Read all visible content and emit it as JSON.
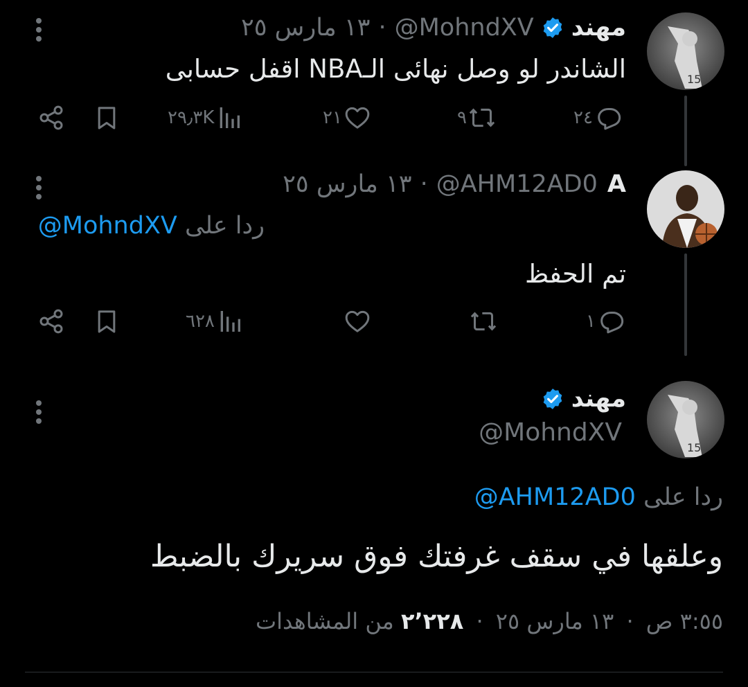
{
  "tweets": [
    {
      "author_name": "مهند",
      "verified": true,
      "handle": "@MohndXV",
      "separator": "·",
      "date": "١٣ مارس ٢٥",
      "text": "الشاندر لو وصل نهائى الـNBA اقفل حسابى",
      "actions": {
        "replies": "٢٤",
        "retweets": "٩",
        "likes": "٢١",
        "views": "٢٩٫٣K"
      }
    },
    {
      "author_name": "A",
      "verified": false,
      "handle": "@AHM12AD0",
      "separator": "·",
      "date": "١٣ مارس ٢٥",
      "reply_prefix": "ردا على",
      "reply_handle": "@MohndXV",
      "text": "تم الحفظ",
      "actions": {
        "replies": "١",
        "retweets": "",
        "likes": "",
        "views": "٦٢٨"
      }
    }
  ],
  "main_tweet": {
    "author_name": "مهند",
    "verified": true,
    "handle": "@MohndXV",
    "reply_prefix": "ردا على",
    "reply_handle": "@AHM12AD0",
    "text": "وعلقها في سقف غرفتك فوق سريرك بالضبط",
    "time": "٣:٥٥ ص",
    "separator": "·",
    "date": "١٣ مارس ٢٥",
    "views_count": "٢٬٢٢٨",
    "views_label": "من المشاهدات"
  },
  "colors": {
    "background": "#000000",
    "text": "#e7e9ea",
    "muted": "#71767b",
    "link": "#1d9bf0",
    "verified_badge": "#1d9bf0"
  },
  "icons": [
    "more-vertical-icon",
    "verified-badge-icon",
    "reply-icon",
    "retweet-icon",
    "like-icon",
    "views-icon",
    "bookmark-icon",
    "share-icon"
  ]
}
